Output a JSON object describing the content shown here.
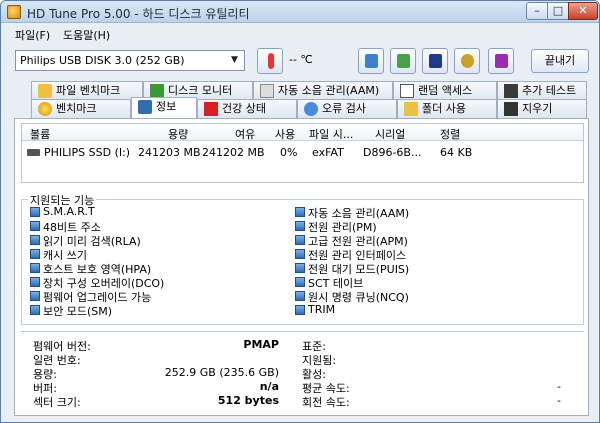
{
  "window": {
    "title": "HD Tune Pro 5.00 - 하드 디스크 유틸리티",
    "min_label": "–",
    "max_label": "□",
    "close_label": "✕"
  },
  "menu": {
    "file": "파일(F)",
    "help": "도움말(H)"
  },
  "toolbar": {
    "drive": "Philips USB DISK 3.0     (252 GB)",
    "temperature": "-- ℃",
    "exit_label": "끝내기"
  },
  "tabs_row1": [
    {
      "label": "파일 벤치마크",
      "icon": "file-benchmark-icon"
    },
    {
      "label": "디스크 모니터",
      "icon": "disk-monitor-icon"
    },
    {
      "label": "자동 소음 관리(AAM)",
      "icon": "speaker-icon"
    },
    {
      "label": "랜덤 액세스",
      "icon": "random-access-icon"
    },
    {
      "label": "추가 테스트",
      "icon": "extra-tests-icon"
    }
  ],
  "tabs_row2": [
    {
      "label": "벤치마크",
      "icon": "benchmark-icon"
    },
    {
      "label": "정보",
      "icon": "info-icon"
    },
    {
      "label": "건강 상태",
      "icon": "health-icon"
    },
    {
      "label": "오류 검사",
      "icon": "error-scan-icon"
    },
    {
      "label": "폴더 사용",
      "icon": "folder-usage-icon"
    },
    {
      "label": "지우기",
      "icon": "erase-icon"
    }
  ],
  "partition_table": {
    "headers": [
      "볼륨",
      "용량",
      "여유",
      "사용",
      "파일 시...",
      "시리얼",
      "정렬"
    ],
    "rows": [
      [
        "PHILIPS SSD (I:)",
        "241203 MB",
        "241202 MB",
        "0%",
        "exFAT",
        "D896-6B...",
        "64 KB"
      ]
    ]
  },
  "features": {
    "title": "지원되는 기능",
    "left": [
      "S.M.A.R.T",
      "48비트 주소",
      "읽기 미리 검색(RLA)",
      "캐시 쓰기",
      "호스트 보호 영역(HPA)",
      "장치 구성 오버레이(DCO)",
      "펌웨어 업그레이드 가능",
      "보안 모드(SM)"
    ],
    "right": [
      "자동 소음 관리(AAM)",
      "전원 관리(PM)",
      "고급 전원 관리(APM)",
      "전원 관리 인터페이스",
      "전원 대기 모드(PUIS)",
      "SCT 테이브",
      "원시 명령 큐닝(NCQ)",
      "TRIM"
    ]
  },
  "info": {
    "left": [
      {
        "label": "펌웨어 버전:",
        "value": "PMAP"
      },
      {
        "label": "일련 번호:",
        "value": ""
      },
      {
        "label": "용량:",
        "value": "252.9 GB (235.6 GB)"
      },
      {
        "label": "버퍼:",
        "value": "n/a"
      },
      {
        "label": "섹터 크기:",
        "value": "512 bytes"
      }
    ],
    "right": [
      {
        "label": "표준:",
        "value": ""
      },
      {
        "label": "지원됨:",
        "value": ""
      },
      {
        "label": "활성:",
        "value": ""
      },
      {
        "label": "평균 속도:",
        "value": "-"
      },
      {
        "label": "회전 속도:",
        "value": "-"
      }
    ]
  },
  "colors": {
    "accent": "#2f6db6",
    "window_bg": "#e9eef5"
  }
}
